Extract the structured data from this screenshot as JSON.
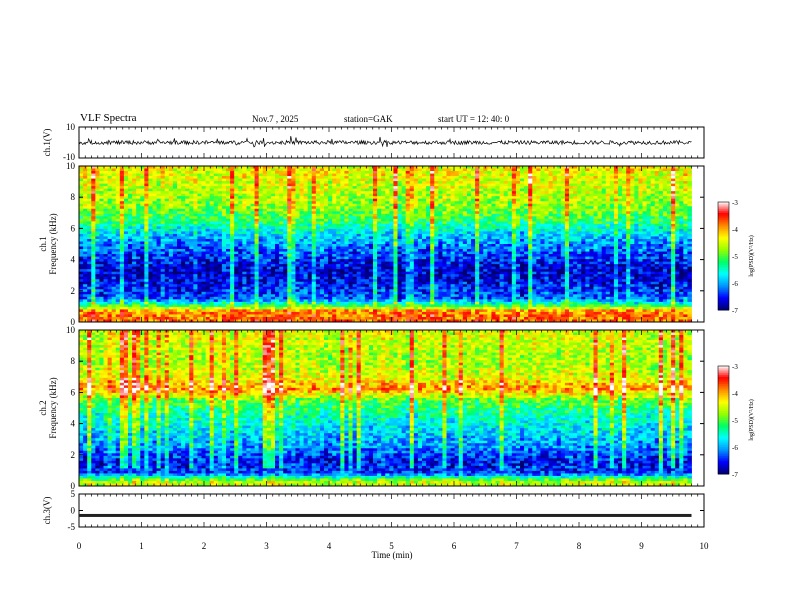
{
  "header": {
    "title": "VLF  Spectra",
    "date": "Nov.7  , 2025",
    "station": "station=GAK",
    "start": "start  UT =   12: 40: 0"
  },
  "chart_data": [
    {
      "type": "line",
      "panel": "ch1-waveform",
      "ylabel": "ch.1(V)",
      "ylim": [
        -10,
        10
      ],
      "yticks": [
        "10",
        "-10"
      ],
      "description_values": {
        "baseline_v": 0,
        "typical_amplitude_v": 2.5
      }
    },
    {
      "type": "heatmap",
      "panel": "ch1-spectrogram",
      "ylabel": "ch.1\nFrequency  (kHz)",
      "ylim": [
        0,
        10
      ],
      "yticks": [
        "0",
        "2",
        "4",
        "6",
        "8",
        "10"
      ],
      "colorbar": {
        "label": "log(PSD)(V²/Hz)",
        "range": [
          -7,
          -3
        ],
        "ticks": [
          "-3",
          "-4",
          "-5",
          "-6",
          "-7"
        ]
      },
      "band_profile": [
        {
          "f_khz": 0.3,
          "level": -3.8
        },
        {
          "f_khz": 0.7,
          "level": -3.9
        },
        {
          "f_khz": 1.0,
          "level": -5.0
        },
        {
          "f_khz": 1.5,
          "level": -6.3
        },
        {
          "f_khz": 2.5,
          "level": -6.6
        },
        {
          "f_khz": 3.5,
          "level": -6.7
        },
        {
          "f_khz": 4.5,
          "level": -6.3
        },
        {
          "f_khz": 5.5,
          "level": -5.9
        },
        {
          "f_khz": 6.5,
          "level": -5.2
        },
        {
          "f_khz": 7.5,
          "level": -4.8
        },
        {
          "f_khz": 8.5,
          "level": -4.6
        },
        {
          "f_khz": 9.5,
          "level": -4.4
        }
      ]
    },
    {
      "type": "heatmap",
      "panel": "ch2-spectrogram",
      "ylabel": "ch.2\nFrequency  (kHz)",
      "ylim": [
        0,
        10
      ],
      "yticks": [
        "0",
        "2",
        "4",
        "6",
        "8",
        "10"
      ],
      "colorbar": {
        "label": "log(PSD)(V²/Hz)",
        "range": [
          -7,
          -3
        ],
        "ticks": [
          "-3",
          "-4",
          "-5",
          "-6",
          "-7"
        ]
      },
      "band_profile": [
        {
          "f_khz": 0.3,
          "level": -4.6
        },
        {
          "f_khz": 0.8,
          "level": -6.4
        },
        {
          "f_khz": 1.5,
          "level": -6.6
        },
        {
          "f_khz": 2.5,
          "level": -6.1
        },
        {
          "f_khz": 3.5,
          "level": -5.8
        },
        {
          "f_khz": 4.5,
          "level": -5.5
        },
        {
          "f_khz": 5.5,
          "level": -5.0
        },
        {
          "f_khz": 6.2,
          "level": -3.9
        },
        {
          "f_khz": 7.0,
          "level": -4.5
        },
        {
          "f_khz": 8.0,
          "level": -4.7
        },
        {
          "f_khz": 9.0,
          "level": -4.6
        },
        {
          "f_khz": 9.8,
          "level": -4.5
        }
      ]
    },
    {
      "type": "line",
      "panel": "ch3-waveform",
      "ylabel": "ch.3(V)",
      "ylim": [
        -5,
        5
      ],
      "yticks": [
        "5",
        "0",
        "-5"
      ],
      "description_values": {
        "baseline_v": -1.5
      }
    }
  ],
  "xaxis": {
    "label": "Time  (min)",
    "range": [
      0,
      10
    ],
    "ticks": [
      "0",
      "1",
      "2",
      "3",
      "4",
      "5",
      "6",
      "7",
      "8",
      "9",
      "10"
    ],
    "data_end_min": 9.8
  },
  "colors": {
    "scale": [
      "#00006e",
      "#0000ff",
      "#0096ff",
      "#00ffff",
      "#00ff64",
      "#96ff00",
      "#ffff00",
      "#ff8c00",
      "#ff0000",
      "#ffffff"
    ]
  }
}
